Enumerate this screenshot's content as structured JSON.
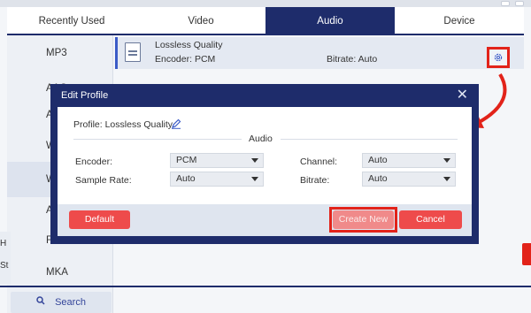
{
  "tabs": [
    {
      "label": "Recently Used"
    },
    {
      "label": "Video"
    },
    {
      "label": "Audio"
    },
    {
      "label": "Device"
    }
  ],
  "sidebar": {
    "items": [
      {
        "label": "MP3"
      },
      {
        "label": "AAC"
      },
      {
        "label": "A"
      },
      {
        "label": "W"
      },
      {
        "label": "W"
      },
      {
        "label": "A"
      },
      {
        "label": "F"
      },
      {
        "label": "MKA"
      }
    ],
    "search_label": "Search"
  },
  "profile_row": {
    "title": "Lossless Quality",
    "encoder": "Encoder: PCM",
    "bitrate": "Bitrate: Auto"
  },
  "background": {
    "h_text": "H",
    "st_text": "St"
  },
  "dialog": {
    "title": "Edit Profile",
    "profile_label": "Profile: Lossless Quality",
    "section_title": "Audio",
    "encoder_label": "Encoder:",
    "encoder_value": "PCM",
    "channel_label": "Channel:",
    "channel_value": "Auto",
    "sample_rate_label": "Sample Rate:",
    "sample_rate_value": "Auto",
    "bitrate_label": "Bitrate:",
    "bitrate_value": "Auto",
    "default_label": "Default",
    "create_new_label": "Create New",
    "cancel_label": "Cancel"
  },
  "colors": {
    "navy": "#1e2c6b",
    "accent_red": "#ee4b4b",
    "highlight_red": "#e2231a"
  }
}
